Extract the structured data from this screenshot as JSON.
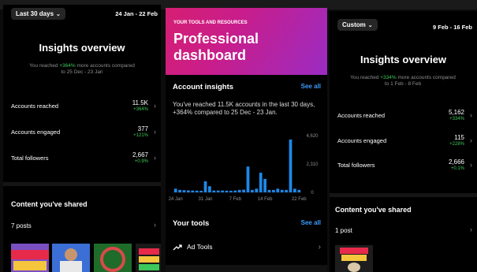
{
  "left": {
    "date_dropdown": "Last 30 days",
    "date_range": "24 Jan - 22 Feb",
    "title": "Insights overview",
    "summary_prefix": "You reached ",
    "summary_pct": "+364%",
    "summary_suffix": " more accounts compared",
    "summary_line2": "to 25 Dec - 23 Jan",
    "rows": [
      {
        "label": "Accounts reached",
        "value": "11.5K",
        "change": "+364%"
      },
      {
        "label": "Accounts engaged",
        "value": "377",
        "change": "+121%"
      },
      {
        "label": "Total followers",
        "value": "2,667",
        "change": "+0.9%"
      }
    ],
    "content_title": "Content you've shared",
    "posts": "7 posts"
  },
  "center": {
    "kicker": "YOUR TOOLS AND RESOURCES",
    "title_line1": "Professional",
    "title_line2": "dashboard",
    "insights_title": "Account insights",
    "see_all": "See all",
    "insights_text": "You've reached 11.5K accounts in the last 30 days, +364% compared to 25 Dec - 23 Jan.",
    "tools_title": "Your tools",
    "tools_see_all": "See all",
    "ad_tools": "Ad Tools"
  },
  "right": {
    "date_dropdown": "Custom",
    "date_range": "9 Feb - 16 Feb",
    "title": "Insights overview",
    "summary_prefix": "You reached ",
    "summary_pct": "+334%",
    "summary_suffix": " more accounts compared",
    "summary_line2": "to 1 Feb - 8 Feb",
    "rows": [
      {
        "label": "Accounts reached",
        "value": "5,162",
        "change": "+334%"
      },
      {
        "label": "Accounts engaged",
        "value": "115",
        "change": "+228%"
      },
      {
        "label": "Total followers",
        "value": "2,666",
        "change": "+0.1%"
      }
    ],
    "content_title": "Content you've shared",
    "posts": "1 post"
  },
  "chart_data": {
    "type": "bar",
    "categories": [
      "24 Jan",
      "25 Jan",
      "26 Jan",
      "27 Jan",
      "28 Jan",
      "29 Jan",
      "30 Jan",
      "31 Jan",
      "1 Feb",
      "2 Feb",
      "3 Feb",
      "4 Feb",
      "5 Feb",
      "6 Feb",
      "7 Feb",
      "8 Feb",
      "9 Feb",
      "10 Feb",
      "11 Feb",
      "12 Feb",
      "13 Feb",
      "14 Feb",
      "15 Feb",
      "16 Feb",
      "17 Feb",
      "18 Feb",
      "19 Feb",
      "20 Feb",
      "21 Feb",
      "22 Feb"
    ],
    "values": [
      300,
      200,
      180,
      160,
      150,
      140,
      130,
      900,
      500,
      150,
      150,
      150,
      140,
      130,
      150,
      200,
      220,
      2100,
      200,
      300,
      1600,
      1100,
      200,
      200,
      300,
      200,
      200,
      4300,
      300,
      200
    ],
    "x_tick_labels": [
      "24 Jan",
      "31 Jan",
      "7 Feb",
      "14 Feb",
      "22 Feb"
    ],
    "y_tick_labels": [
      "4,620",
      "2,310",
      "0"
    ],
    "ylim": [
      0,
      4620
    ],
    "color": "#1f87e6"
  },
  "colors": {
    "accent_blue": "#3b9dff",
    "positive": "#3cc85a",
    "bar": "#1f87e6"
  }
}
